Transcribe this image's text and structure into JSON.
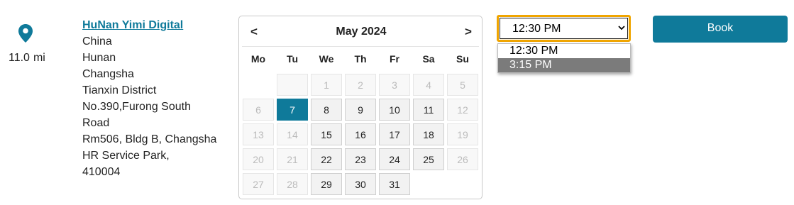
{
  "location": {
    "pin_icon": "map-pin-icon",
    "distance_value": "11.0",
    "distance_unit": "mi",
    "name": "HuNan Yimi Digital",
    "address_lines": [
      "China",
      "Hunan",
      "Changsha",
      "Tianxin District",
      "No.390,Furong South",
      "Road",
      "Rm506, Bldg B, Changsha",
      "HR Service Park,",
      "410004"
    ]
  },
  "calendar": {
    "prev_label": "<",
    "next_label": ">",
    "month_title": "May 2024",
    "weekdays": [
      "Mo",
      "Tu",
      "We",
      "Th",
      "Fr",
      "Sa",
      "Su"
    ],
    "weeks": [
      [
        "",
        "",
        "1",
        "2",
        "3",
        "4",
        "5"
      ],
      [
        "6",
        "7",
        "8",
        "9",
        "10",
        "11",
        "12"
      ],
      [
        "13",
        "14",
        "15",
        "16",
        "17",
        "18",
        "19"
      ],
      [
        "20",
        "21",
        "22",
        "23",
        "24",
        "25",
        "26"
      ],
      [
        "27",
        "28",
        "29",
        "30",
        "31",
        "",
        ""
      ]
    ],
    "states": [
      [
        "blank",
        "dis",
        "dis",
        "dis",
        "dis",
        "dis",
        "dis"
      ],
      [
        "dis",
        "sel",
        "en",
        "en",
        "en",
        "en",
        "dis"
      ],
      [
        "dis",
        "dis",
        "en",
        "en",
        "en",
        "en",
        "dis"
      ],
      [
        "dis",
        "dis",
        "en",
        "en",
        "en",
        "en",
        "dis"
      ],
      [
        "dis",
        "dis",
        "en",
        "en",
        "en",
        "blank",
        "blank"
      ]
    ],
    "selected_day": "7",
    "accent_color": "#0f7a9a"
  },
  "time": {
    "selected": "12:30 PM",
    "options": [
      "12:30 PM",
      "3:15 PM"
    ],
    "highlighted_option": "3:15 PM",
    "focus_color": "#f0a500"
  },
  "book_button": {
    "label": "Book",
    "color": "#0f7a9a"
  }
}
